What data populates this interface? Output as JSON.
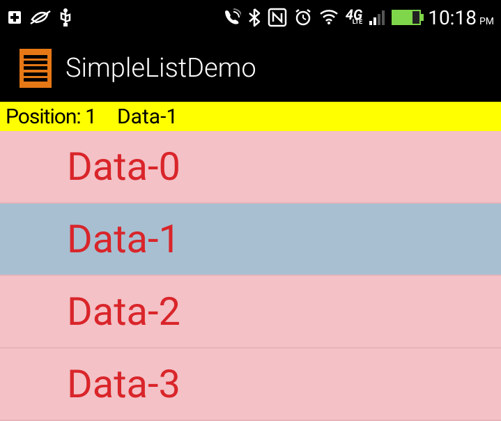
{
  "status_bar": {
    "time": "10:18",
    "ampm": "PM",
    "lte_main": "4G",
    "lte_sub": "LTE"
  },
  "app_bar": {
    "title": "SimpleListDemo"
  },
  "selection": {
    "position_label": "Position: 1",
    "data_label": "Data-1"
  },
  "list": {
    "items": [
      {
        "label": "Data-0",
        "selected": false
      },
      {
        "label": "Data-1",
        "selected": true
      },
      {
        "label": "Data-2",
        "selected": false
      },
      {
        "label": "Data-3",
        "selected": false
      }
    ]
  }
}
